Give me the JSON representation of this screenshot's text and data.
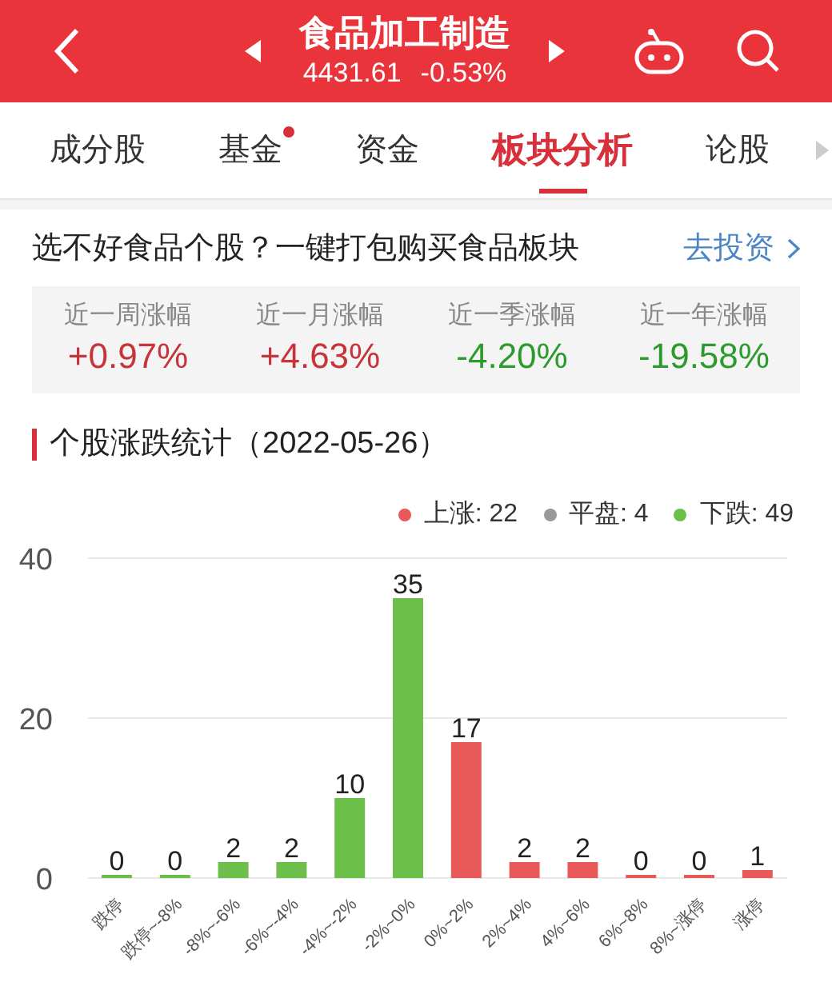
{
  "header": {
    "title": "食品加工制造",
    "price": "4431.61",
    "change": "-0.53%"
  },
  "tabs": [
    {
      "label": "成分股",
      "selected": false,
      "dot": false
    },
    {
      "label": "基金",
      "selected": false,
      "dot": true
    },
    {
      "label": "资金",
      "selected": false,
      "dot": false
    },
    {
      "label": "板块分析",
      "selected": true,
      "dot": false
    },
    {
      "label": "论股",
      "selected": false,
      "dot": false
    }
  ],
  "promo": {
    "text": "选不好食品个股？一键打包购买食品板块",
    "link": "去投资"
  },
  "stats": [
    {
      "label": "近一周涨幅",
      "value": "+0.97%",
      "color": "#c8333a"
    },
    {
      "label": "近一月涨幅",
      "value": "+4.63%",
      "color": "#c8333a"
    },
    {
      "label": "近一季涨幅",
      "value": "-4.20%",
      "color": "#2c9a2c"
    },
    {
      "label": "近一年涨幅",
      "value": "-19.58%",
      "color": "#2c9a2c"
    }
  ],
  "section_title": "个股涨跌统计（2022-05-26）",
  "legend": [
    {
      "label": "上涨: 22",
      "color": "#e85a5a"
    },
    {
      "label": "平盘: 4",
      "color": "#999999"
    },
    {
      "label": "下跌: 49",
      "color": "#6cc04a"
    }
  ],
  "chart_data": {
    "type": "bar",
    "stacked": true,
    "categories": [
      "跌停",
      "跌停~-8%",
      "-8%~-6%",
      "-6%~-4%",
      "-4%~-2%",
      "-2%~0%",
      "0%~2%",
      "2%~4%",
      "4%~6%",
      "6%~8%",
      "8%~涨停",
      "涨停"
    ],
    "series": [
      {
        "color": "#6cc04a",
        "values": [
          0,
          0,
          2,
          2,
          10,
          35,
          null,
          null,
          null,
          null,
          null,
          null
        ]
      },
      {
        "color": "#e85a5a",
        "values": [
          null,
          null,
          null,
          null,
          null,
          null,
          17,
          2,
          2,
          0,
          0,
          1
        ]
      }
    ],
    "ylim": [
      0,
      40
    ],
    "yticks": [
      0,
      20,
      40
    ],
    "data_labels": true
  }
}
